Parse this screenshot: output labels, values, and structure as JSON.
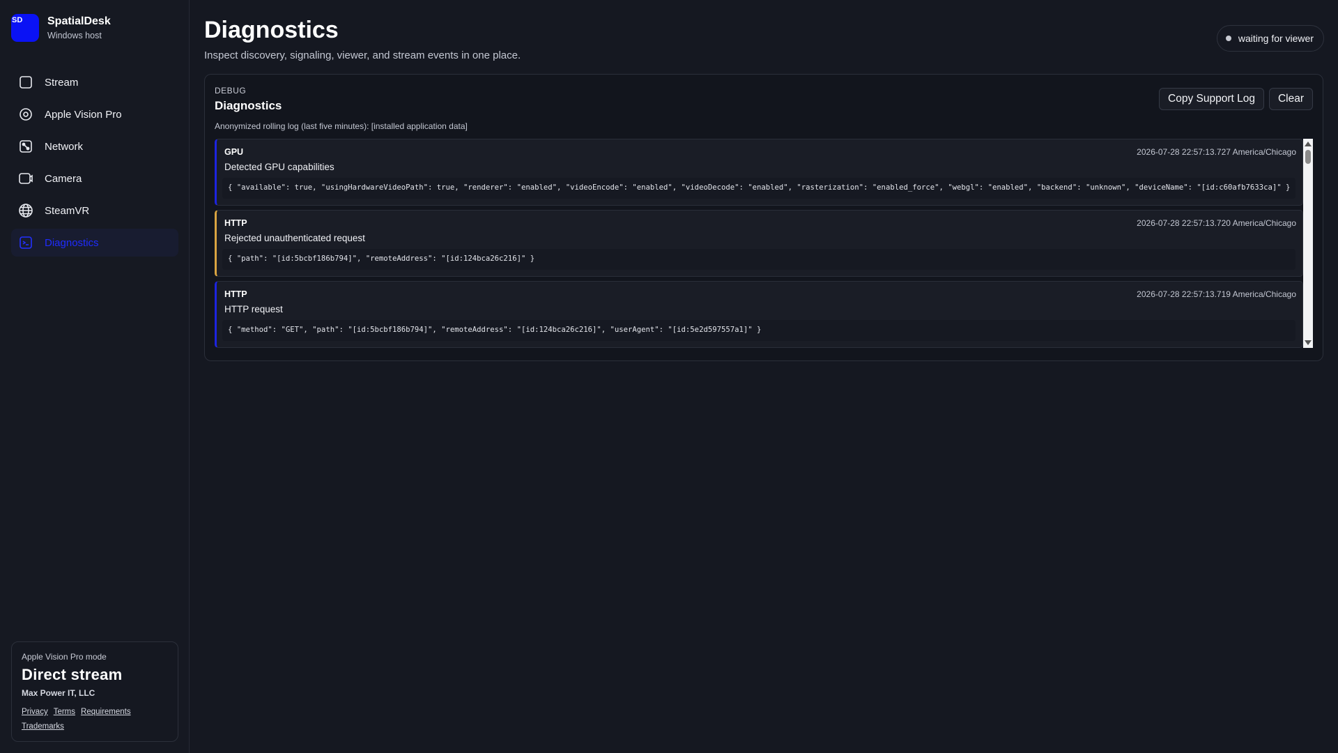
{
  "brand": {
    "logo_text": "SD",
    "name": "SpatialDesk",
    "subtitle": "Windows host"
  },
  "nav": {
    "items": [
      {
        "label": "Stream",
        "icon": "square-icon"
      },
      {
        "label": "Apple Vision Pro",
        "icon": "target-icon"
      },
      {
        "label": "Network",
        "icon": "network-icon"
      },
      {
        "label": "Camera",
        "icon": "camera-icon"
      },
      {
        "label": "SteamVR",
        "icon": "globe-icon"
      },
      {
        "label": "Diagnostics",
        "icon": "terminal-icon",
        "active": true
      }
    ]
  },
  "mode_card": {
    "label": "Apple Vision Pro mode",
    "title": "Direct stream",
    "company": "Max Power IT, LLC",
    "links": [
      "Privacy",
      "Terms",
      "Requirements",
      "Trademarks"
    ]
  },
  "header": {
    "title": "Diagnostics",
    "subtitle": "Inspect discovery, signaling, viewer, and stream events in one place.",
    "status": "waiting for viewer"
  },
  "panel": {
    "eyebrow": "DEBUG",
    "title": "Diagnostics",
    "description": "Anonymized rolling log (last five minutes): [installed application data]",
    "copy_label": "Copy Support Log",
    "clear_label": "Clear"
  },
  "log_entries": [
    {
      "category": "GPU",
      "timestamp": "2026-07-28 22:57:13.727 America/Chicago",
      "message": "Detected GPU capabilities",
      "payload": "{ \"available\": true, \"usingHardwareVideoPath\": true, \"renderer\": \"enabled\", \"videoEncode\": \"enabled\", \"videoDecode\": \"enabled\", \"rasterization\": \"enabled_force\", \"webgl\": \"enabled\", \"backend\": \"unknown\", \"deviceName\": \"[id:c60afb7633ca]\" }",
      "level": "info"
    },
    {
      "category": "HTTP",
      "timestamp": "2026-07-28 22:57:13.720 America/Chicago",
      "message": "Rejected unauthenticated request",
      "payload": "{ \"path\": \"[id:5bcbf186b794]\", \"remoteAddress\": \"[id:124bca26c216]\" }",
      "level": "warn"
    },
    {
      "category": "HTTP",
      "timestamp": "2026-07-28 22:57:13.719 America/Chicago",
      "message": "HTTP request",
      "payload": "{ \"method\": \"GET\", \"path\": \"[id:5bcbf186b794]\", \"remoteAddress\": \"[id:124bca26c216]\", \"userAgent\": \"[id:5e2d597557a1]\" }",
      "level": "info"
    }
  ],
  "colors": {
    "accent": "#1f2cff",
    "warn": "#d9a441",
    "background": "#151821"
  }
}
